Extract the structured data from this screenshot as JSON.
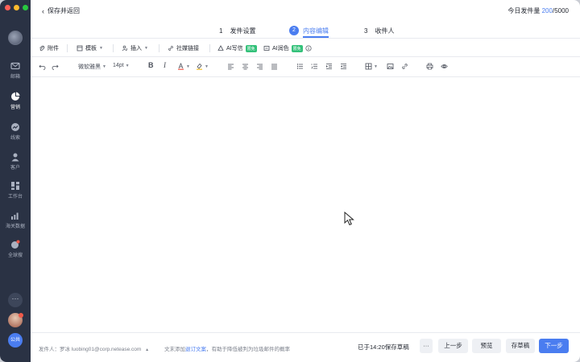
{
  "sidebar": {
    "items": [
      {
        "label": "邮箱",
        "icon": "mail-icon"
      },
      {
        "label": "营销",
        "icon": "pie-chart-icon",
        "active": true
      },
      {
        "label": "线索",
        "icon": "trend-icon"
      },
      {
        "label": "客户",
        "icon": "person-icon"
      },
      {
        "label": "工作台",
        "icon": "grid-icon"
      },
      {
        "label": "海关数据",
        "icon": "bar-chart-icon"
      },
      {
        "label": "全球搜",
        "icon": "globe-search-icon"
      }
    ],
    "more_label": "···",
    "public_label": "公共"
  },
  "header": {
    "back_label": "保存并返回",
    "quota_label": "今日发件量",
    "quota_used": "200",
    "quota_total": "/5000"
  },
  "steps": [
    {
      "num": "1",
      "label": "发件设置"
    },
    {
      "num": "2",
      "label": "内容编辑",
      "active": true
    },
    {
      "num": "3",
      "label": "收件人"
    }
  ],
  "toolbar1": {
    "attachment": "附件",
    "template": "模板",
    "insert": "插入",
    "social_link": "社媒链接",
    "ai_write": "AI写信",
    "ai_polish": "AI润色",
    "tag": "限免"
  },
  "toolbar2": {
    "font": "微软雅黑",
    "size": "14pt"
  },
  "footer": {
    "sender_label": "发件人：",
    "sender_name": "罗冰",
    "sender_email": "luobing01@corp.netease.com",
    "hint_prefix": "文末添加",
    "hint_link": "退订文案",
    "hint_suffix": "，有助于降低被判为垃圾邮件的概率",
    "saved_text": "已于14:20保存草稿",
    "more": "···",
    "prev": "上一步",
    "preview": "预览",
    "draft": "存草稿",
    "next": "下一步"
  },
  "colors": {
    "accent": "#4a7df0",
    "sidebar_bg": "#2a3244",
    "tag_green": "#34c17a"
  }
}
